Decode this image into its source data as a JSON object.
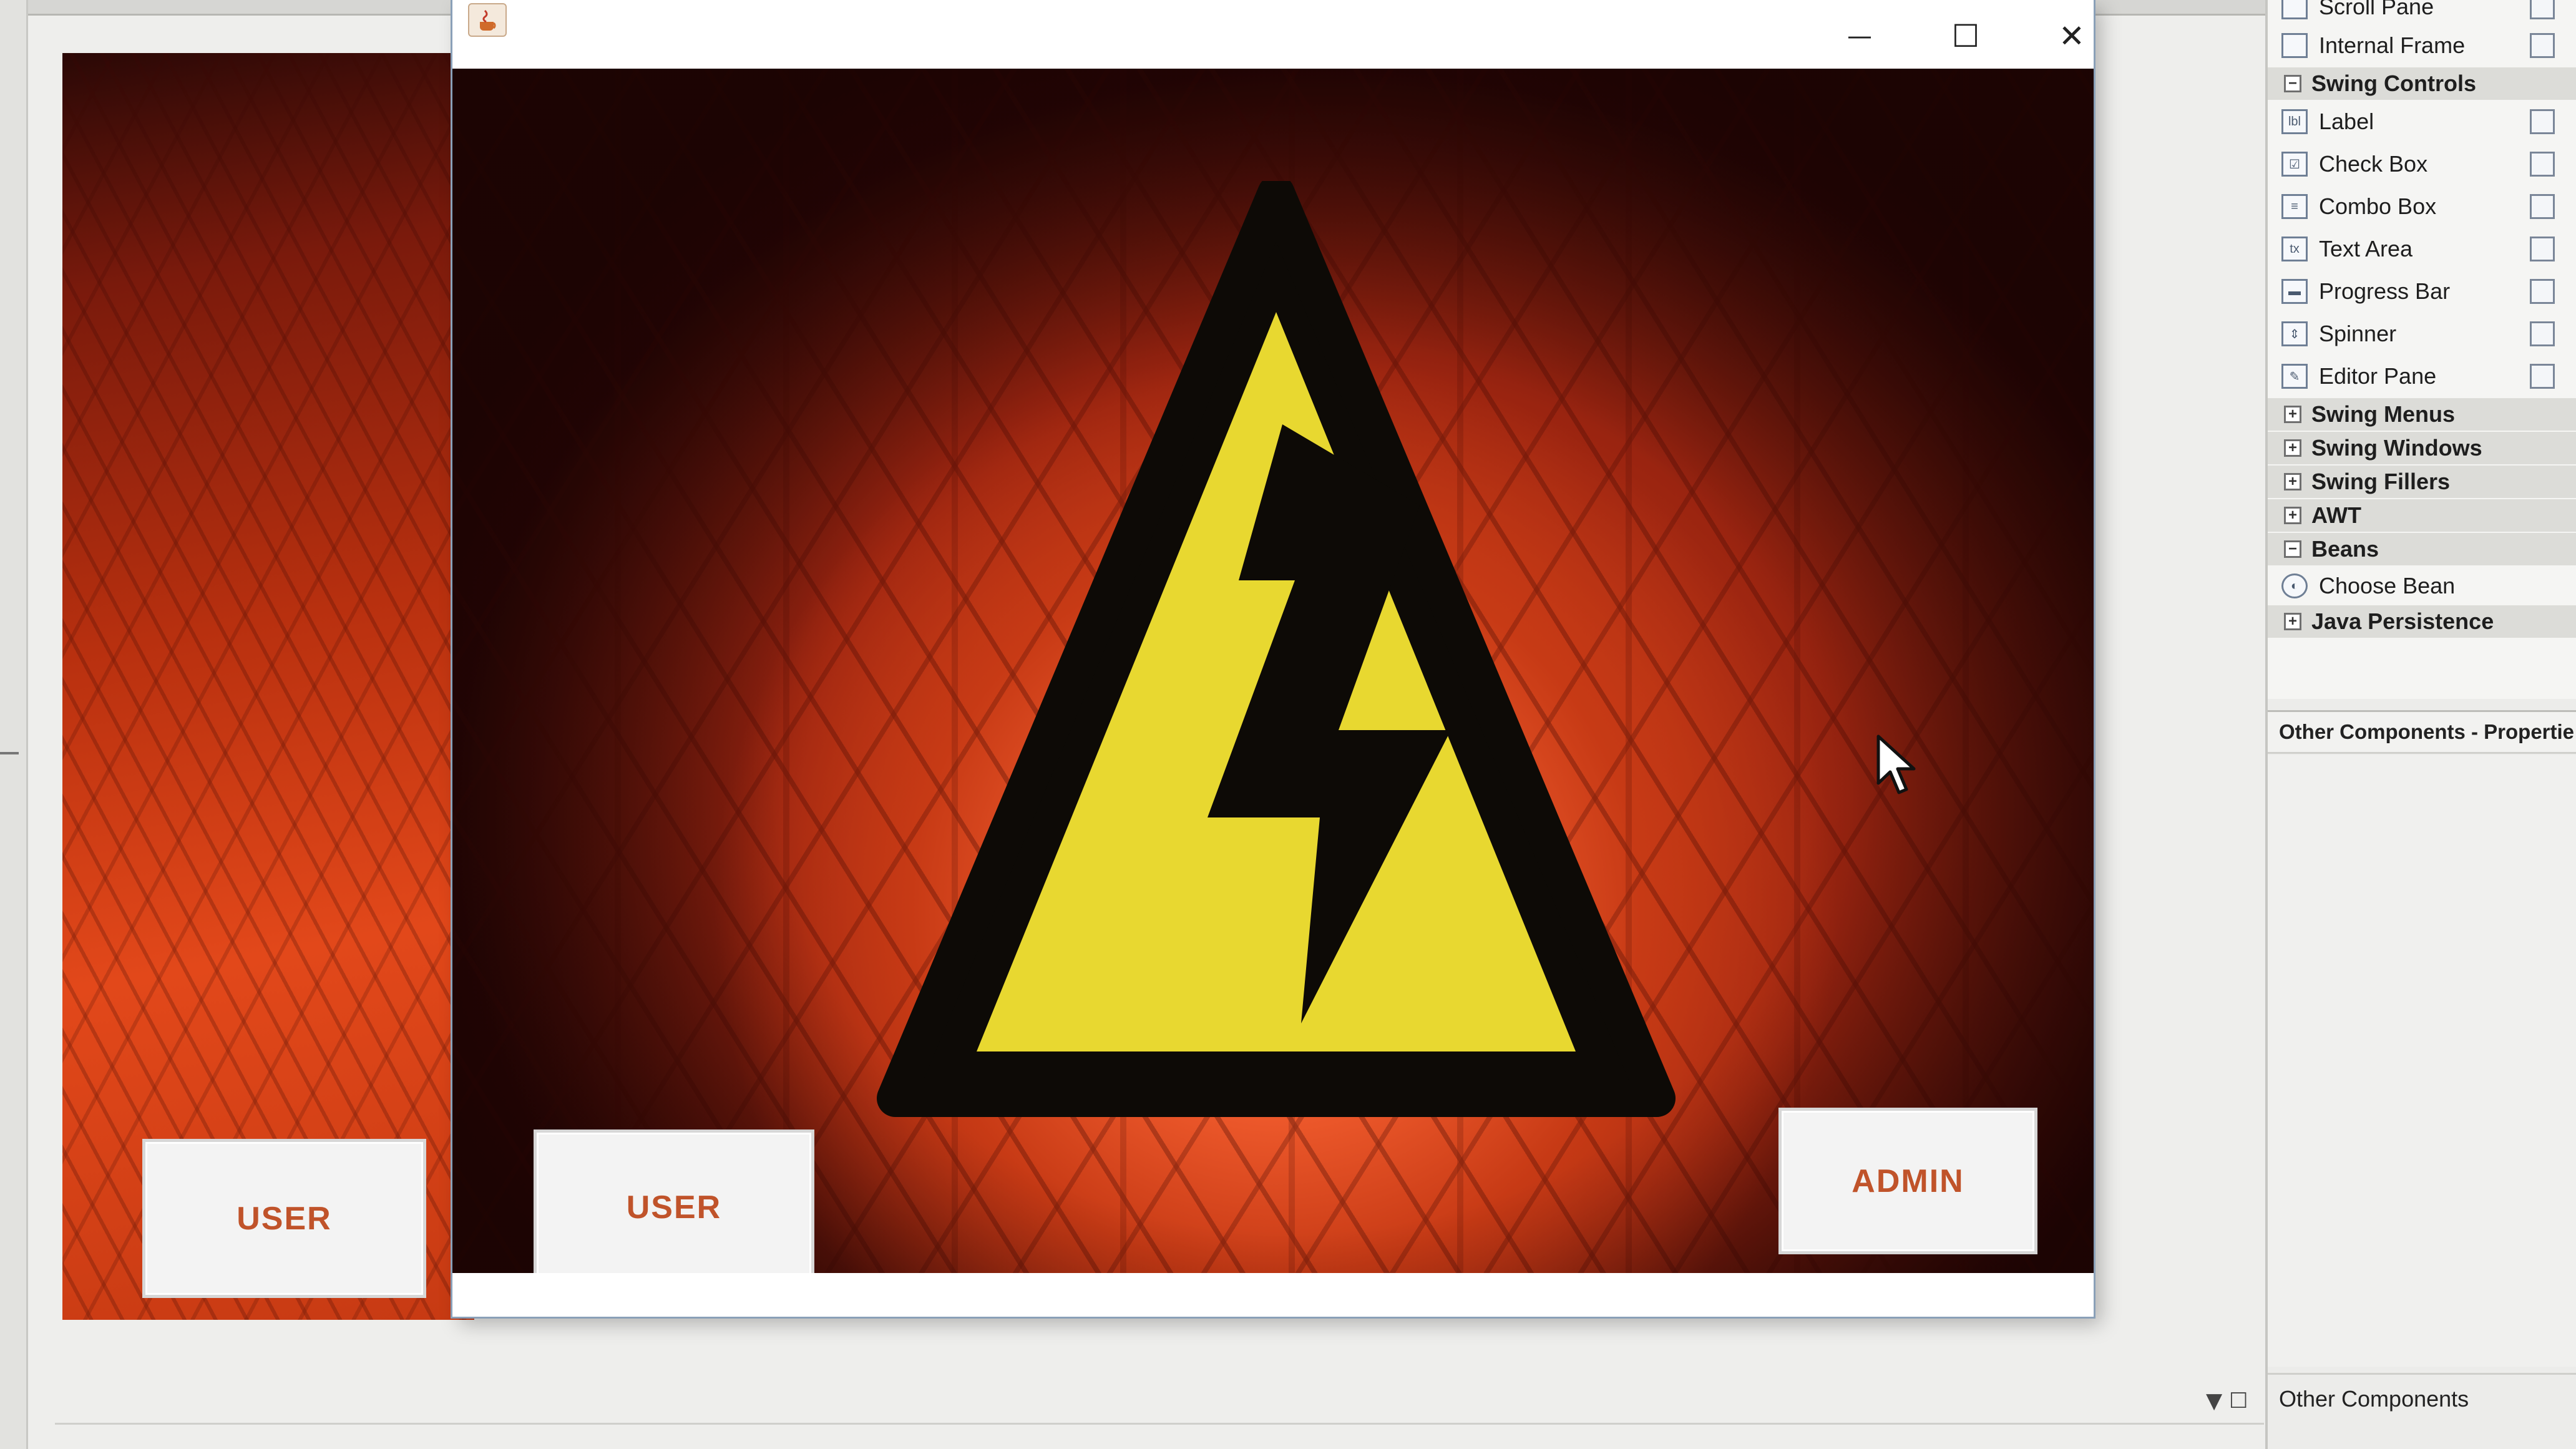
{
  "main_window": {
    "controls": {
      "minimize_icon": "—",
      "maximize_icon": "☐",
      "close_icon": "✕"
    },
    "buttons": {
      "user": "USER",
      "admin": "ADMIN"
    }
  },
  "background_form": {
    "user_button": "USER"
  },
  "palette": {
    "items_top": [
      "Scroll Pane",
      "Internal Frame"
    ],
    "swing_controls_header": "Swing Controls",
    "swing_controls": [
      "Label",
      "Check Box",
      "Combo Box",
      "Text Area",
      "Progress Bar",
      "Spinner",
      "Editor Pane"
    ],
    "collapsed_categories": [
      "Swing Menus",
      "Swing Windows",
      "Swing Fillers",
      "AWT"
    ],
    "beans_header": "Beans",
    "beans_items": [
      "Choose Bean"
    ],
    "java_persistence": "Java Persistence"
  },
  "properties_panel": {
    "title": "Other Components - Propertie"
  },
  "bottom_panel": {
    "label": "Other Components"
  }
}
